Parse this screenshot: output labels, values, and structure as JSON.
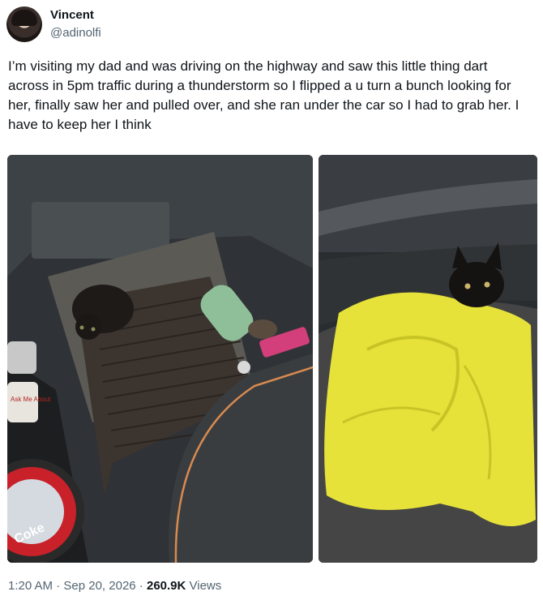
{
  "author": {
    "display_name": "Vincent",
    "handle": "@adinolfi"
  },
  "tweet": {
    "text": "I’m visiting my dad and was driving on the highway and saw this little thing dart across in 5pm traffic during a thunderstorm so I flipped a u turn a bunch looking for her, finally saw her and pulled over, and she ran under the car so I had to grab her. I have to keep her I think"
  },
  "media": {
    "left_can_text": "Coke",
    "left_label_text": "Ask Me About"
  },
  "meta": {
    "time": "1:20 AM",
    "separator1": " · ",
    "date": "Sep 20, 2026",
    "separator2": " · ",
    "views_count": "260.9K",
    "views_label": " Views"
  },
  "colors": {
    "text_primary": "#0f1419",
    "text_secondary": "#536471",
    "towel": "#e6e23a",
    "can_red": "#d8262a"
  }
}
